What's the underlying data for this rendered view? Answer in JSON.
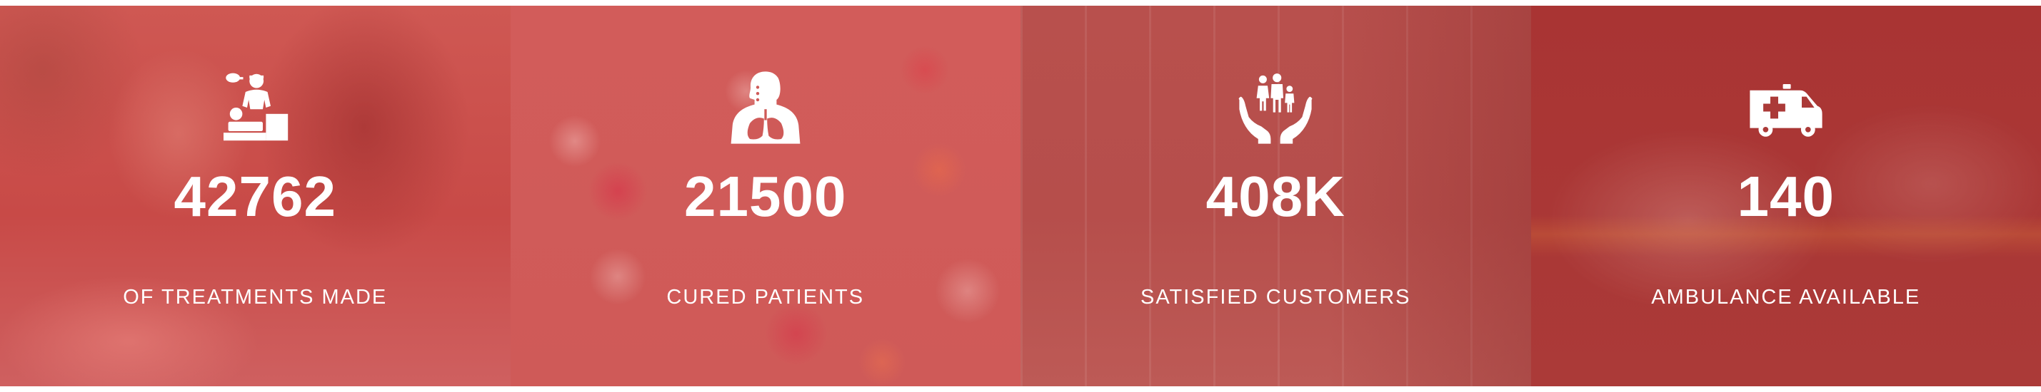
{
  "stats": [
    {
      "icon": "doctor-treatment-icon",
      "value": "42762",
      "label": "OF TREATMENTS MADE"
    },
    {
      "icon": "lungs-patient-icon",
      "value": "21500",
      "label": "CURED PATIENTS"
    },
    {
      "icon": "family-hands-icon",
      "value": "408K",
      "label": "SATISFIED CUSTOMERS"
    },
    {
      "icon": "ambulance-icon",
      "value": "140",
      "label": "AMBULANCE AVAILABLE"
    }
  ],
  "colors": {
    "overlay_red": "#c84a47",
    "text": "#ffffff"
  }
}
